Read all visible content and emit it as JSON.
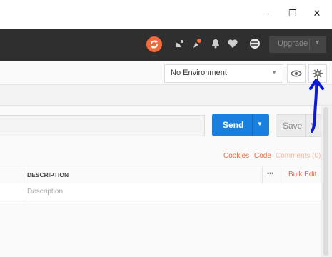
{
  "window": {
    "minimize_glyph": "–",
    "restore_glyph": "❐",
    "close_glyph": "✕"
  },
  "toolbar": {
    "upgrade_label": "Upgrade",
    "icons": [
      "sync-icon",
      "satellite-icon",
      "notification-feed-icon",
      "bell-icon",
      "heart-icon",
      "globe-icon"
    ]
  },
  "environment": {
    "selected": "No Environment"
  },
  "request": {
    "send_label": "Send",
    "save_label": "Save"
  },
  "links": {
    "cookies": "Cookies",
    "code": "Code",
    "comments": "Comments (0)"
  },
  "params_table": {
    "description_header": "DESCRIPTION",
    "more_glyph": "•••",
    "bulk_edit": "Bulk Edit",
    "description_placeholder": "Description"
  },
  "colors": {
    "brand_orange": "#f26b3a",
    "send_blue": "#1a80e0",
    "annotation_blue": "#0b1bd6"
  }
}
